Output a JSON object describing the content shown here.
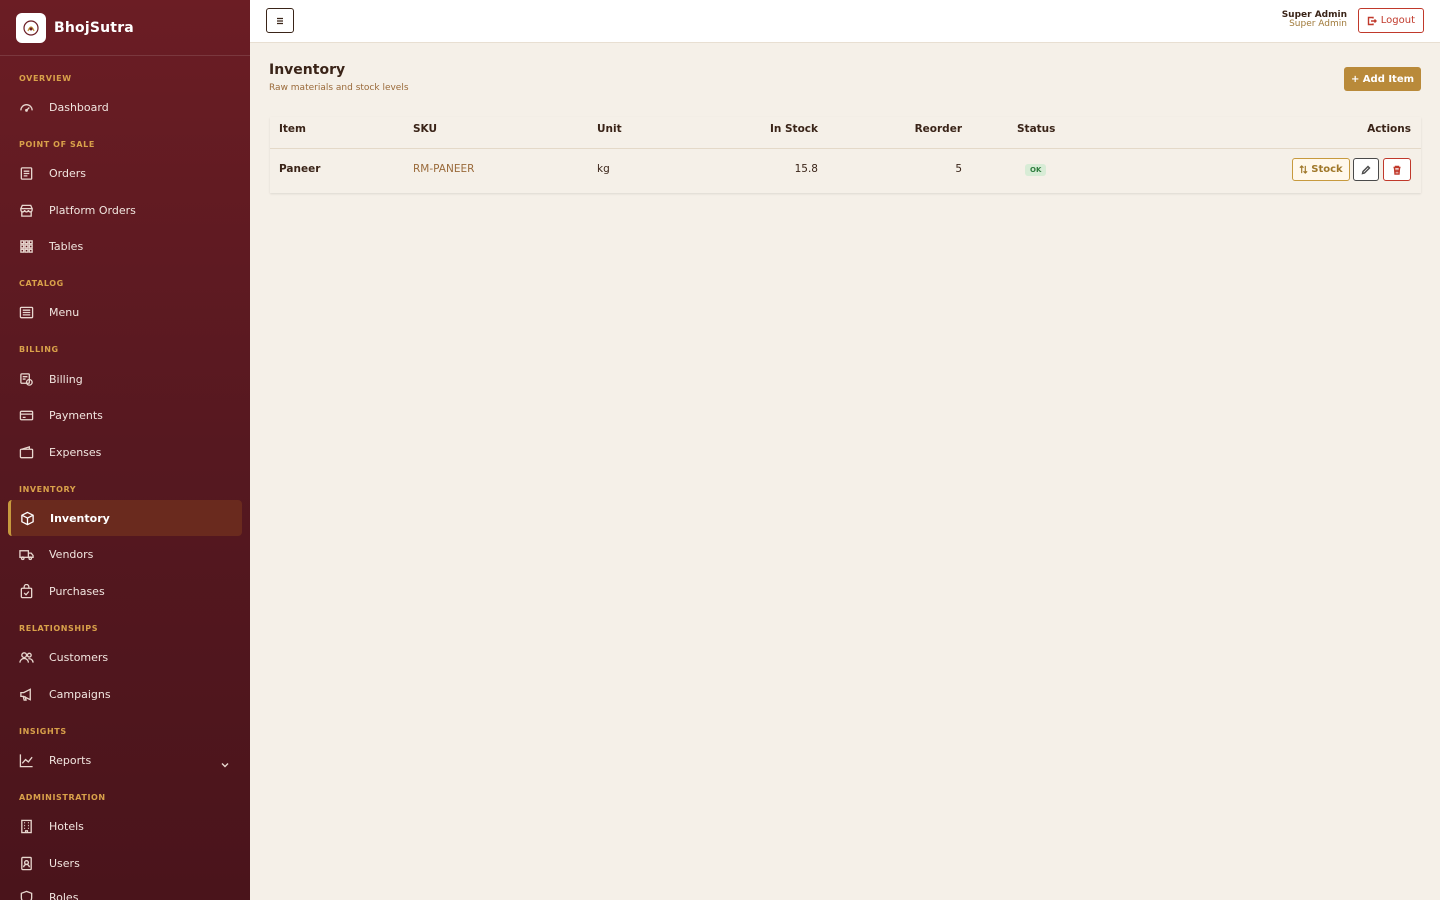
{
  "app": {
    "name": "BhojSutra"
  },
  "sidebar": {
    "sections": [
      {
        "label": "OVERVIEW"
      },
      {
        "label": "POINT OF SALE"
      },
      {
        "label": "CATALOG"
      },
      {
        "label": "BILLING"
      },
      {
        "label": "INVENTORY"
      },
      {
        "label": "RELATIONSHIPS"
      },
      {
        "label": "INSIGHTS"
      },
      {
        "label": "ADMINISTRATION"
      }
    ],
    "items": [
      {
        "label": "Dashboard",
        "icon": "gauge-icon"
      },
      {
        "label": "Orders",
        "icon": "receipt-icon"
      },
      {
        "label": "Platform Orders",
        "icon": "store-icon"
      },
      {
        "label": "Tables",
        "icon": "grid-icon"
      },
      {
        "label": "Menu",
        "icon": "list-icon"
      },
      {
        "label": "Billing",
        "icon": "bill-icon"
      },
      {
        "label": "Payments",
        "icon": "card-icon"
      },
      {
        "label": "Expenses",
        "icon": "wallet-icon"
      },
      {
        "label": "Inventory",
        "icon": "box-icon",
        "active": true
      },
      {
        "label": "Vendors",
        "icon": "truck-icon"
      },
      {
        "label": "Purchases",
        "icon": "bag-check-icon"
      },
      {
        "label": "Customers",
        "icon": "people-icon"
      },
      {
        "label": "Campaigns",
        "icon": "megaphone-icon"
      },
      {
        "label": "Reports",
        "icon": "chart-line-icon"
      },
      {
        "label": "Hotels",
        "icon": "building-icon"
      },
      {
        "label": "Users",
        "icon": "id-badge-icon"
      },
      {
        "label": "Roles",
        "icon": "shield-icon"
      }
    ]
  },
  "topbar": {
    "user_name": "Super Admin",
    "user_role": "Super Admin",
    "logout_label": "Logout"
  },
  "page": {
    "title": "Inventory",
    "subtitle": "Raw materials and stock levels",
    "add_label": "+ Add Item"
  },
  "table": {
    "columns": [
      "Item",
      "SKU",
      "Unit",
      "In Stock",
      "Reorder",
      "Status",
      "Actions"
    ],
    "rows": [
      {
        "item": "Paneer",
        "sku": "RM-PANEER",
        "unit": "kg",
        "in_stock": "15.8",
        "reorder": "5",
        "status": "OK"
      }
    ],
    "stock_label": "Stock"
  },
  "colors": {
    "sidebar_bg": "#5a1a22",
    "accent": "#b98a3a",
    "section_label": "#d9a14a",
    "danger": "#c0392b",
    "ok": "#2f7d3e"
  }
}
